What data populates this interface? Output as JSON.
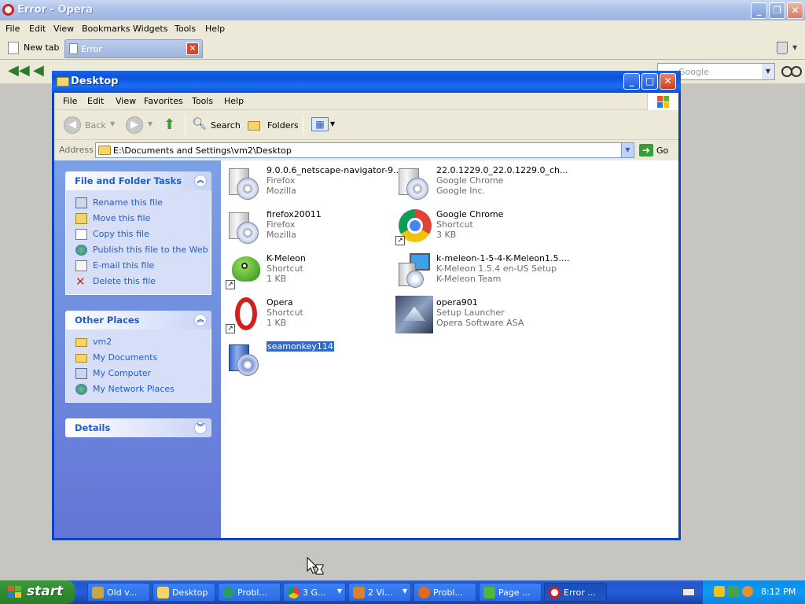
{
  "opera": {
    "title": "Error - Opera",
    "menu": [
      "File",
      "Edit",
      "View",
      "Bookmarks",
      "Widgets",
      "Tools",
      "Help"
    ],
    "tabs": {
      "new_tab": "New tab",
      "active_tab": "Error"
    },
    "search": {
      "placeholder": "Google"
    }
  },
  "explorer": {
    "title": "Desktop",
    "menu": [
      "File",
      "Edit",
      "View",
      "Favorites",
      "Tools",
      "Help"
    ],
    "toolbar": {
      "back": "Back",
      "search": "Search",
      "folders": "Folders"
    },
    "address": {
      "label": "Address",
      "value": "E:\\Documents and Settings\\vm2\\Desktop",
      "go": "Go"
    },
    "side": {
      "file_tasks": {
        "header": "File and Folder Tasks",
        "items": [
          "Rename this file",
          "Move this file",
          "Copy this file",
          "Publish this file to the Web",
          "E-mail this file",
          "Delete this file"
        ]
      },
      "other_places": {
        "header": "Other Places",
        "items": [
          "vm2",
          "My Documents",
          "My Computer",
          "My Network Places"
        ]
      },
      "details": {
        "header": "Details"
      }
    },
    "files": [
      {
        "name": "9.0.0.6_netscape-navigator-9...",
        "line2": "Firefox",
        "line3": "Mozilla"
      },
      {
        "name": "22.0.1229.0_22.0.1229.0_ch...",
        "line2": "Google Chrome",
        "line3": "Google Inc."
      },
      {
        "name": "firefox20011",
        "line2": "Firefox",
        "line3": "Mozilla"
      },
      {
        "name": "Google Chrome",
        "line2": "Shortcut",
        "line3": "3 KB"
      },
      {
        "name": "K-Meleon",
        "line2": "Shortcut",
        "line3": "1 KB"
      },
      {
        "name": "k-meleon-1-5-4-K-Meleon1.5....",
        "line2": "K-Meleon 1.5.4 en-US Setup",
        "line3": "K-Meleon Team"
      },
      {
        "name": "Opera",
        "line2": "Shortcut",
        "line3": "1 KB"
      },
      {
        "name": "opera901",
        "line2": "Setup Launcher",
        "line3": "Opera Software ASA"
      },
      {
        "name": "seamonkey114",
        "line2": "",
        "line3": ""
      }
    ]
  },
  "taskbar": {
    "start": "start",
    "buttons": [
      "Old v...",
      "Desktop",
      "Probl...",
      "3 G...",
      "2 Vi...",
      "Probl...",
      "Page ...",
      "Error ..."
    ],
    "clock": "8:12 PM"
  },
  "colors": {
    "xp_blue": "#0a4fd3",
    "link_blue": "#215dc6",
    "selection": "#316ac5",
    "start_green": "#2f8a2f"
  }
}
